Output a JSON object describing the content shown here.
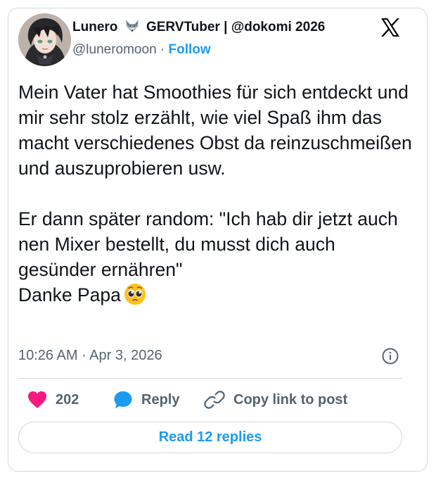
{
  "author": {
    "display_name_part1": "Lunero",
    "display_name_part2": "GERVTuber | @dokomi 2026",
    "handle": "@luneromoon",
    "separator": "·",
    "follow_label": "Follow"
  },
  "icons": {
    "name_emoji": "fox-icon",
    "platform": "x-logo-icon",
    "text_emoji": "pleading-face-icon",
    "info": "info-icon",
    "like": "heart-icon",
    "reply": "speech-bubble-icon",
    "copy": "link-icon"
  },
  "tweet": {
    "text": "Mein Vater hat Smoothies für sich entdeckt und mir sehr stolz erzählt, wie viel Spaß ihm das macht verschiedenes Obst da reinzuschmeißen und auszuprobieren usw.\n\nEr dann später random: \"Ich hab dir jetzt auch nen Mixer bestellt, du musst dich auch gesünder ernähren\"\nDanke Papa",
    "timestamp": "10:26 AM · Apr 3, 2026"
  },
  "actions": {
    "likes_count": "202",
    "reply_label": "Reply",
    "copy_label": "Copy link to post"
  },
  "replies_button_label": "Read 12 replies",
  "colors": {
    "accent": "#1d9bf0",
    "heart": "#f91880",
    "secondary_text": "#536471",
    "border": "#cfd9de"
  }
}
